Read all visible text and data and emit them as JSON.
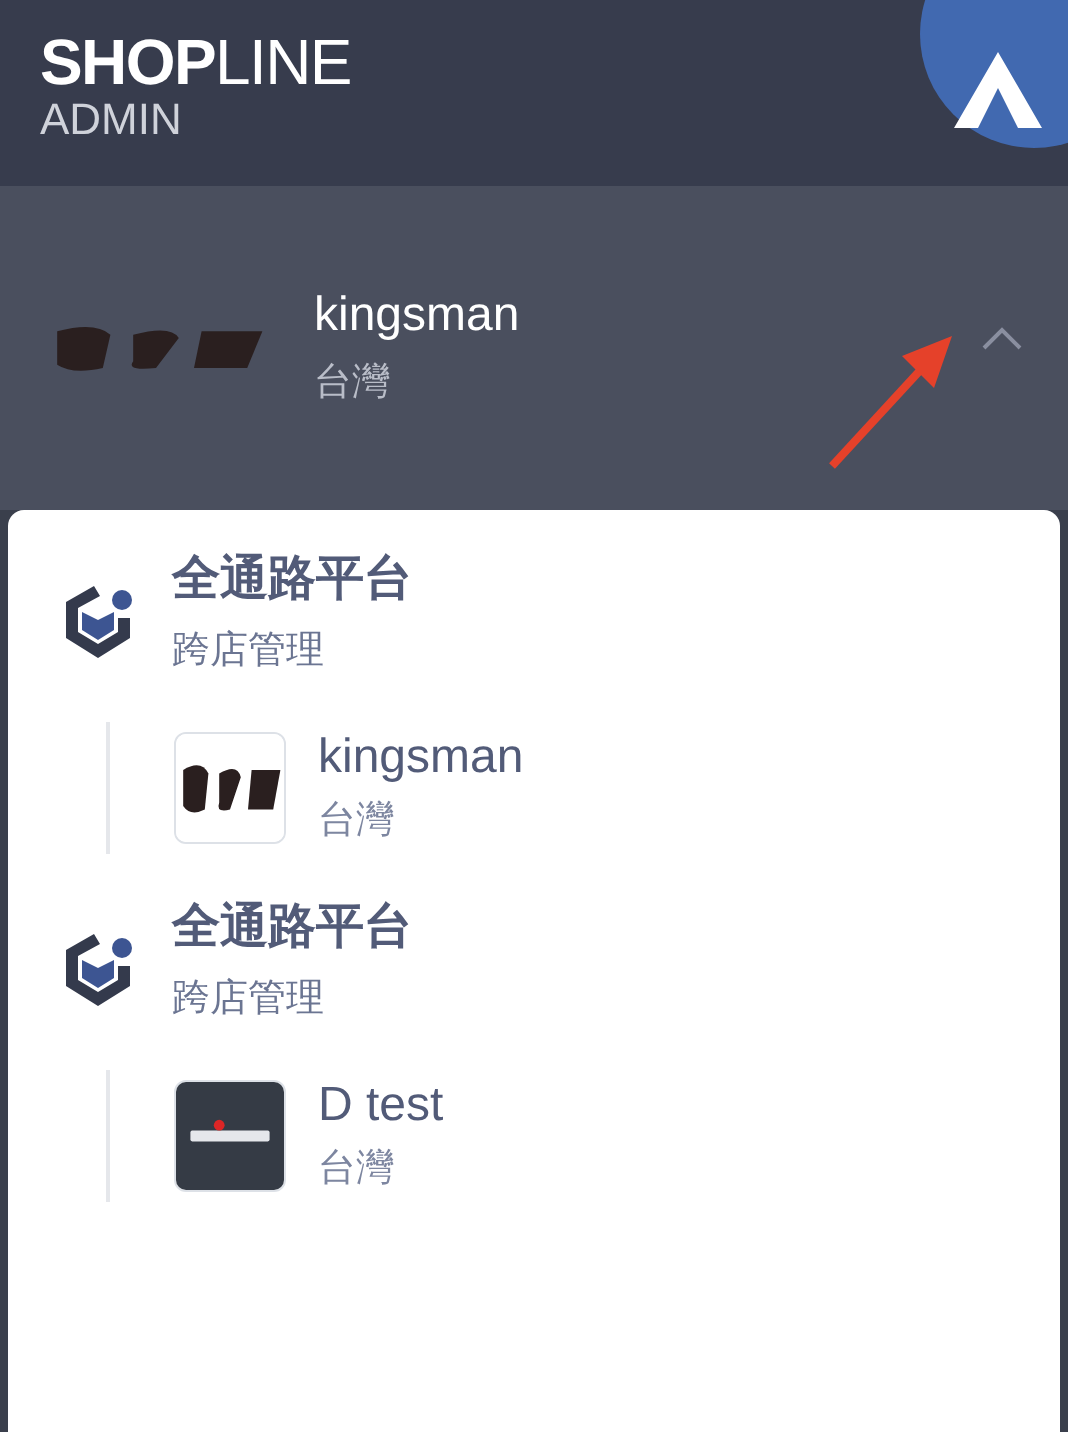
{
  "brand": {
    "logo": "**SHOP**LINE",
    "subtitle": "ADMIN"
  },
  "current_store": {
    "name": "kingsman",
    "region": "台灣",
    "expanded": true,
    "avatar": {
      "kind": "bare"
    }
  },
  "groups": [
    {
      "title": "全通路平台",
      "subtitle": "跨店管理",
      "stores": [
        {
          "name": "kingsman",
          "region": "台灣",
          "avatar": {
            "kind": "light"
          }
        }
      ]
    },
    {
      "title": "全通路平台",
      "subtitle": "跨店管理",
      "stores": [
        {
          "name": "D test",
          "region": "台灣",
          "avatar": {
            "kind": "dark"
          }
        }
      ]
    }
  ]
}
